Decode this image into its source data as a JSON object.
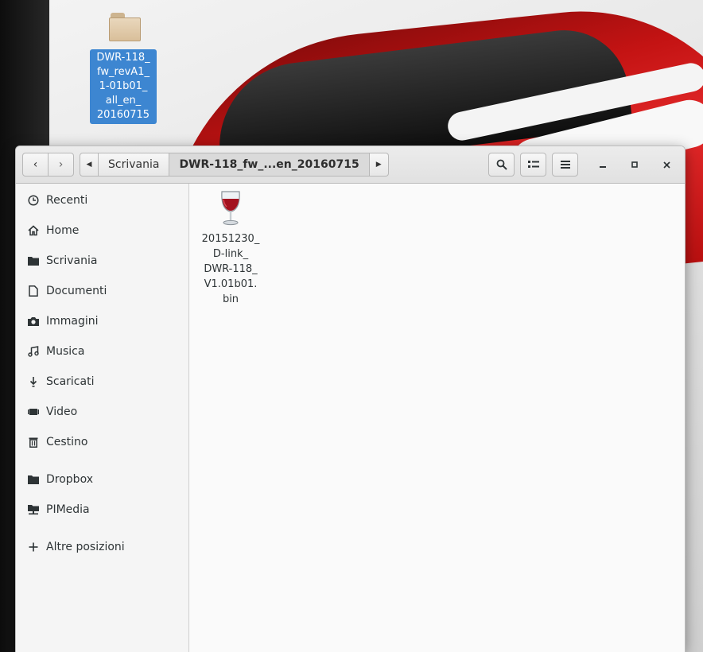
{
  "desktop": {
    "icon_label": "DWR-118_\nfw_revA1_\n1-01b01_\nall_en_\n20160715"
  },
  "window": {
    "path": {
      "items": [
        "Scrivania",
        "DWR-118_fw_...en_20160715"
      ]
    },
    "sidebar": {
      "items": [
        {
          "label": "Recenti",
          "icon": "clock-icon"
        },
        {
          "label": "Home",
          "icon": "home-icon"
        },
        {
          "label": "Scrivania",
          "icon": "folder-icon"
        },
        {
          "label": "Documenti",
          "icon": "document-icon"
        },
        {
          "label": "Immagini",
          "icon": "camera-icon"
        },
        {
          "label": "Musica",
          "icon": "music-icon"
        },
        {
          "label": "Scaricati",
          "icon": "download-icon"
        },
        {
          "label": "Video",
          "icon": "video-icon"
        },
        {
          "label": "Cestino",
          "icon": "trash-icon"
        },
        {
          "label": "Dropbox",
          "icon": "folder-icon"
        },
        {
          "label": "PIMedia",
          "icon": "network-icon"
        },
        {
          "label": "Altre posizioni",
          "icon": "plus-icon"
        }
      ]
    },
    "files": [
      {
        "label": "20151230_\nD-link_\nDWR-118_\nV1.01b01.\nbin",
        "icon": "wine-glass-icon"
      }
    ]
  }
}
